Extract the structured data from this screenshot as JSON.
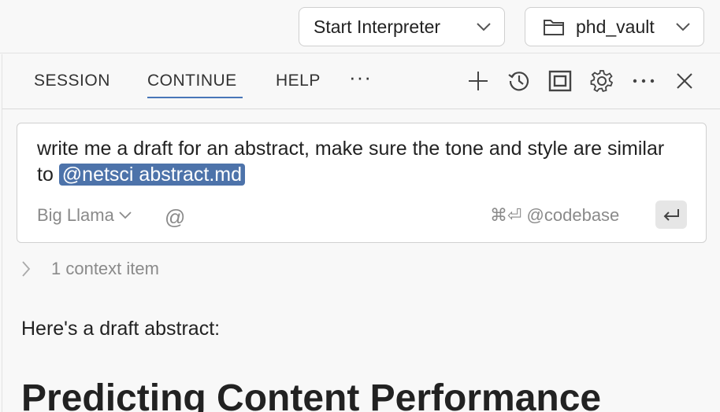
{
  "topbar": {
    "interpreter_label": "Start Interpreter",
    "vault_label": "phd_vault"
  },
  "tabs": [
    {
      "label": "SESSION"
    },
    {
      "label": "CONTINUE"
    },
    {
      "label": "HELP"
    },
    {
      "label": "···"
    }
  ],
  "active_tab": "CONTINUE",
  "input": {
    "text_before": "write me a draft for an abstract, make sure the tone and style are similar to ",
    "mention": "@netsci abstract.md",
    "model": "Big Llama",
    "at_symbol": "@",
    "shortcut": "⌘⏎ @codebase"
  },
  "context": {
    "label": "1 context item"
  },
  "reply": {
    "intro": "Here's a draft abstract:",
    "heading": "Predicting Content Performance"
  },
  "colors": {
    "accent": "#4876b8",
    "mention_bg": "#4d73aa"
  }
}
